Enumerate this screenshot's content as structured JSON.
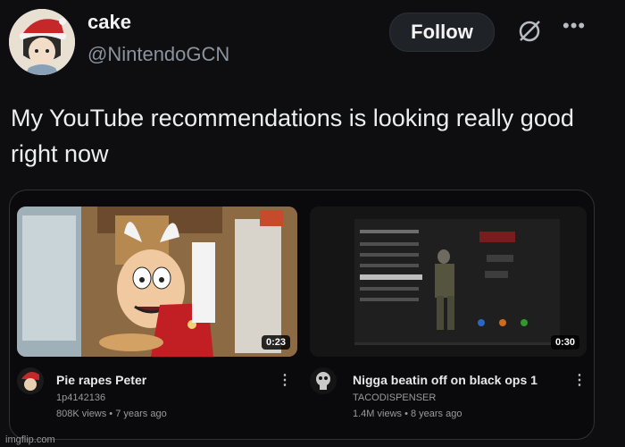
{
  "post": {
    "display_name": "cake",
    "handle": "@NintendoGCN",
    "follow_label": "Follow",
    "text": "My YouTube recommendations is looking really good right now"
  },
  "videos": [
    {
      "title": "Pie rapes Peter",
      "channel": "1p4142136",
      "meta": "808K views • 7 years ago",
      "duration": "0:23"
    },
    {
      "title": "Nigga beatin off on black ops 1",
      "channel": "TACODISPENSER",
      "meta": "1.4M views • 8 years ago",
      "duration": "0:30"
    }
  ],
  "watermark": "imgflip.com",
  "icons": [
    "avatar",
    "grok-icon",
    "more-icon",
    "vertical-menu-icon"
  ],
  "colors": {
    "background": "#0e0e11",
    "text": "#e7e9ea",
    "muted": "#8b949e",
    "button": "#1f2328"
  }
}
